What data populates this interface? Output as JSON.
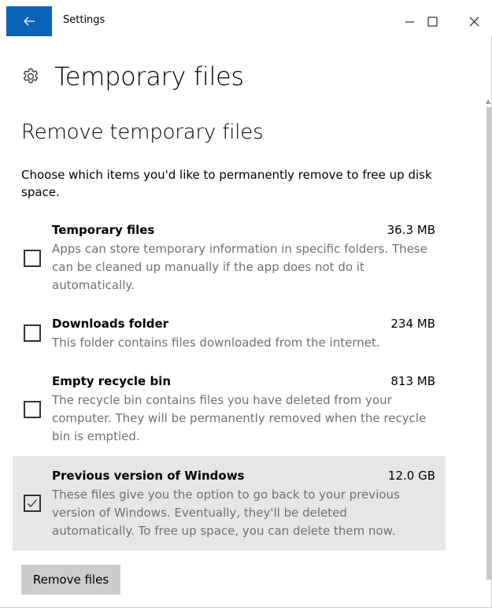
{
  "titlebar": {
    "app_title": "Settings",
    "back_icon": "back-arrow-icon",
    "minimize_icon": "minimize-icon",
    "maximize_icon": "maximize-icon",
    "close_icon": "close-icon",
    "accent_color": "#0b63b7"
  },
  "header": {
    "icon": "gear-icon",
    "title": "Temporary files"
  },
  "main": {
    "section_title": "Remove temporary files",
    "intro": "Choose which items you'd like to permanently remove to free up disk space.",
    "items": [
      {
        "name": "Temporary files",
        "size": "36.3 MB",
        "description": "Apps can store temporary information in specific folders. These can be cleaned up manually if the app does not do it automatically.",
        "checked": false
      },
      {
        "name": "Downloads folder",
        "size": "234 MB",
        "description": "This folder contains files downloaded from the internet.",
        "checked": false
      },
      {
        "name": "Empty recycle bin",
        "size": "813 MB",
        "description": "The recycle bin contains files you have deleted from your computer. They will be permanently removed when the recycle bin is emptied.",
        "checked": false
      },
      {
        "name": "Previous version of Windows",
        "size": "12.0 GB",
        "description": "These files give you the option to go back to your previous version of Windows. Eventually, they'll be deleted automatically. To free up space, you can delete them now.",
        "checked": true
      }
    ],
    "remove_button": "Remove files"
  }
}
